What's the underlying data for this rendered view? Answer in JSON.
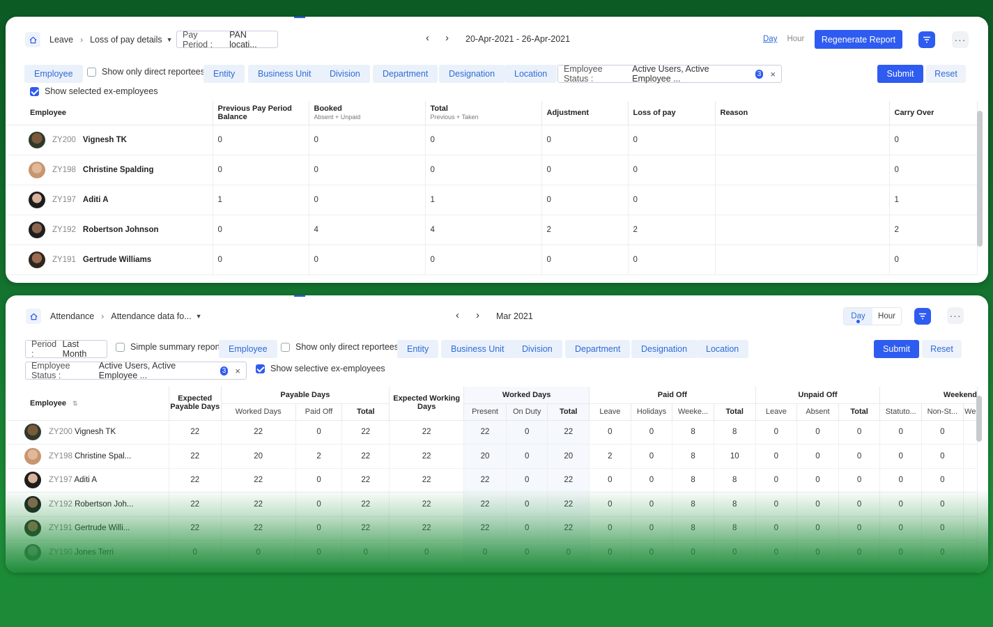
{
  "panel1": {
    "breadcrumb": {
      "home": "home-icon",
      "leave": "Leave",
      "report": "Loss of pay details"
    },
    "pay_period": {
      "key": "Pay Period :",
      "value": "PAN locati..."
    },
    "date_range": "20-Apr-2021 - 26-Apr-2021",
    "day_label": "Day",
    "hour_label": "Hour",
    "regenerate": "Regenerate Report",
    "filters": {
      "employee": "Employee",
      "direct": "Show only direct reportees",
      "entity": "Entity",
      "business_unit": "Business Unit",
      "division": "Division",
      "department": "Department",
      "designation": "Designation",
      "location": "Location",
      "status_key": "Employee Status :",
      "status_value": "Active Users, Active Employee ...",
      "status_count": "3",
      "ex_employees": "Show selected ex-employees",
      "submit": "Submit",
      "reset": "Reset"
    },
    "columns": {
      "employee": "Employee",
      "prev": "Previous Pay Period Balance",
      "booked": "Booked",
      "booked_sub": "Absent + Unpaid",
      "total": "Total",
      "total_sub": "Previous + Taken",
      "adjustment": "Adjustment",
      "lop": "Loss of pay",
      "reason": "Reason",
      "carry": "Carry Over"
    },
    "rows": [
      {
        "code": "ZY200",
        "name": "Vignesh TK",
        "prev": "0",
        "booked": "0",
        "total": "0",
        "adj": "0",
        "lop": "0",
        "reason": "",
        "carry": "0"
      },
      {
        "code": "ZY198",
        "name": "Christine Spalding",
        "prev": "0",
        "booked": "0",
        "total": "0",
        "adj": "0",
        "lop": "0",
        "reason": "",
        "carry": "0"
      },
      {
        "code": "ZY197",
        "name": "Aditi A",
        "prev": "1",
        "booked": "0",
        "total": "1",
        "adj": "0",
        "lop": "0",
        "reason": "",
        "carry": "1"
      },
      {
        "code": "ZY192",
        "name": "Robertson Johnson",
        "prev": "0",
        "booked": "4",
        "total": "4",
        "adj": "2",
        "lop": "2",
        "reason": "",
        "carry": "2"
      },
      {
        "code": "ZY191",
        "name": "Gertrude Williams",
        "prev": "0",
        "booked": "0",
        "total": "0",
        "adj": "0",
        "lop": "0",
        "reason": "",
        "carry": "0"
      }
    ]
  },
  "panel2": {
    "breadcrumb": {
      "home": "home-icon",
      "attendance": "Attendance",
      "report": "Attendance data fo..."
    },
    "month": "Mar 2021",
    "day_label": "Day",
    "hour_label": "Hour",
    "filters": {
      "period_key": "Period :",
      "period_value": "Last Month",
      "summary": "Simple summary report",
      "employee": "Employee",
      "direct": "Show only direct reportees",
      "entity": "Entity",
      "business_unit": "Business Unit",
      "division": "Division",
      "department": "Department",
      "designation": "Designation",
      "location": "Location",
      "status_key": "Employee Status :",
      "status_value": "Active Users, Active Employee ...",
      "status_count": "3",
      "ex_employees": "Show selective ex-employees",
      "submit": "Submit",
      "reset": "Reset"
    },
    "groups": {
      "employee": "Employee",
      "expected": "Expected Payable Days",
      "payable": "Payable Days",
      "working": "Expected Working Days",
      "worked": "Worked Days",
      "paidoff": "Paid Off",
      "unpaidoff": "Unpaid Off",
      "weekend": "Weekend"
    },
    "subcols": {
      "p_worked": "Worked Days",
      "p_paid": "Paid Off",
      "p_total": "Total",
      "w_present": "Present",
      "w_onduty": "On Duty",
      "w_total": "Total",
      "po_leave": "Leave",
      "po_holidays": "Holidays",
      "po_weekend": "Weeke...",
      "po_total": "Total",
      "u_leave": "Leave",
      "u_absent": "Absent",
      "u_total": "Total",
      "we_stat": "Statuto...",
      "we_nonst": "Non-St...",
      "we_we": "We"
    },
    "rows": [
      {
        "code": "ZY200",
        "name": "Vignesh TK",
        "vals": [
          "22",
          "22",
          "0",
          "22",
          "22",
          "22",
          "0",
          "22",
          "0",
          "0",
          "8",
          "8",
          "0",
          "0",
          "0",
          "0",
          "0"
        ]
      },
      {
        "code": "ZY198",
        "name": "Christine Spal...",
        "vals": [
          "22",
          "20",
          "2",
          "22",
          "22",
          "20",
          "0",
          "20",
          "2",
          "0",
          "8",
          "10",
          "0",
          "0",
          "0",
          "0",
          "0"
        ]
      },
      {
        "code": "ZY197",
        "name": "Aditi A",
        "vals": [
          "22",
          "22",
          "0",
          "22",
          "22",
          "22",
          "0",
          "22",
          "0",
          "0",
          "8",
          "8",
          "0",
          "0",
          "0",
          "0",
          "0"
        ]
      },
      {
        "code": "ZY192",
        "name": "Robertson Joh...",
        "vals": [
          "22",
          "22",
          "0",
          "22",
          "22",
          "22",
          "0",
          "22",
          "0",
          "0",
          "8",
          "8",
          "0",
          "0",
          "0",
          "0",
          "0"
        ]
      },
      {
        "code": "ZY191",
        "name": "Gertrude Willi...",
        "vals": [
          "22",
          "22",
          "0",
          "22",
          "22",
          "22",
          "0",
          "22",
          "0",
          "0",
          "8",
          "8",
          "0",
          "0",
          "0",
          "0",
          "0"
        ]
      },
      {
        "code": "ZY190",
        "name": "Jones Terri",
        "vals": [
          "0",
          "0",
          "0",
          "0",
          "0",
          "0",
          "0",
          "0",
          "0",
          "0",
          "0",
          "0",
          "0",
          "0",
          "0",
          "0",
          "0"
        ]
      }
    ]
  },
  "colors": {
    "accent": "#2e5bf0",
    "chip_bg": "#eaf1fb",
    "chip_text": "#2e6bd6",
    "background": "#13722e"
  }
}
